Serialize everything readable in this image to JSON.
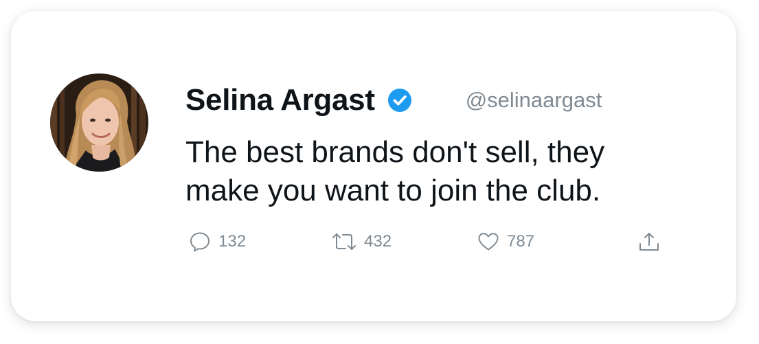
{
  "tweet": {
    "author": {
      "name": "Selina Argast",
      "handle": "@selinaargast",
      "verified": true,
      "avatar_icon": "profile-photo"
    },
    "text_lines": [
      "The best brands don't sell, they",
      "make you want to join the club."
    ],
    "actions": {
      "reply_count": "132",
      "retweet_count": "432",
      "like_count": "787"
    }
  },
  "colors": {
    "verified_blue": "#1d9bf0",
    "text_primary": "#0f1419",
    "text_secondary": "#7f8a93"
  }
}
